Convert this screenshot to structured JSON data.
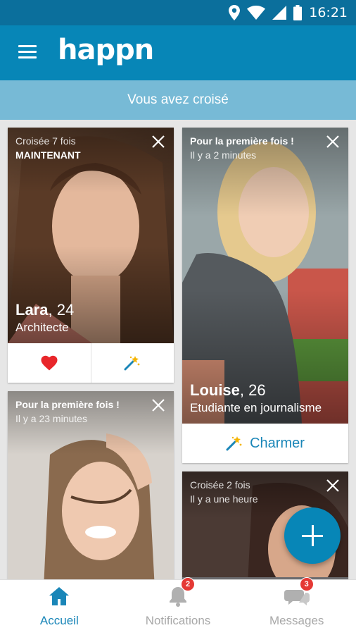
{
  "status_bar": {
    "time": "16:21",
    "icons": [
      "location-icon",
      "wifi-icon",
      "signal-icon",
      "battery-icon"
    ]
  },
  "app_bar": {
    "logo": "happn",
    "menu_icon": "menu-icon"
  },
  "subheader": "Vous avez croisé",
  "cards": [
    {
      "line1": "Croisée 7 fois",
      "line2": "MAINTENANT",
      "name": "Lara",
      "age": ", 24",
      "job": "Architecte",
      "actions": [
        "heart-icon",
        "charm-wand-icon"
      ]
    },
    {
      "line1": "Pour la première fois !",
      "line2": "Il y a 2 minutes",
      "name": "Louise",
      "age": ", 26",
      "job": "Etudiante en journalisme",
      "action_label": "Charmer"
    },
    {
      "line1": "Pour la première fois !",
      "line2": "Il y a 23 minutes"
    },
    {
      "line1": "Croisée 2 fois",
      "line2": "Il y a une heure"
    }
  ],
  "bottom_nav": [
    {
      "label": "Accueil",
      "icon": "home-icon",
      "active": true
    },
    {
      "label": "Notifications",
      "icon": "bell-icon",
      "badge": "2"
    },
    {
      "label": "Messages",
      "icon": "chat-icon",
      "badge": "3"
    }
  ],
  "colors": {
    "primary": "#0786b7",
    "status_bar": "#0b6f9c",
    "subheader": "#77bad6",
    "accent_text": "#1a86b8",
    "badge": "#e53935",
    "heart": "#e8262a"
  }
}
